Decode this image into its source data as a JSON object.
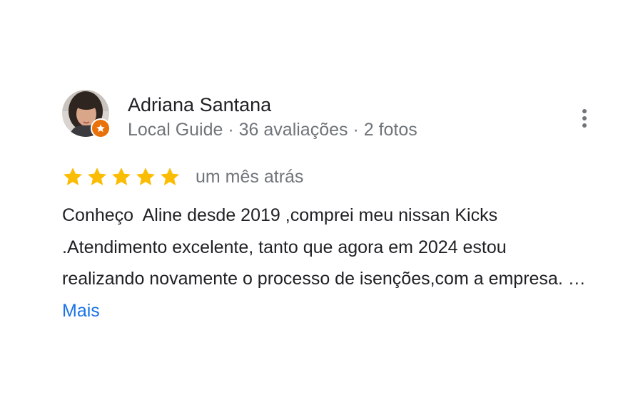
{
  "review": {
    "author": {
      "name": "Adriana Santana",
      "meta": "Local Guide · 36 avaliações · 2 fotos",
      "avatar_icon": "user-photo-icon",
      "badge_icon": "local-guide-star-icon"
    },
    "rating": {
      "stars": 5,
      "max_stars": 5,
      "star_color": "#fbbc04"
    },
    "date": "um mês atrás",
    "text": "Conheço  Aline desde 2019 ,comprei meu nissan Kicks .Atendimento excelente, tanto que agora em 2024 estou realizando novamente o processo de isenções,com a empresa. …",
    "more_label": "Mais",
    "options_icon": "more-vert-icon"
  },
  "colors": {
    "link": "#1a73e8",
    "secondary_text": "#70757a",
    "badge": "#e8710a"
  }
}
